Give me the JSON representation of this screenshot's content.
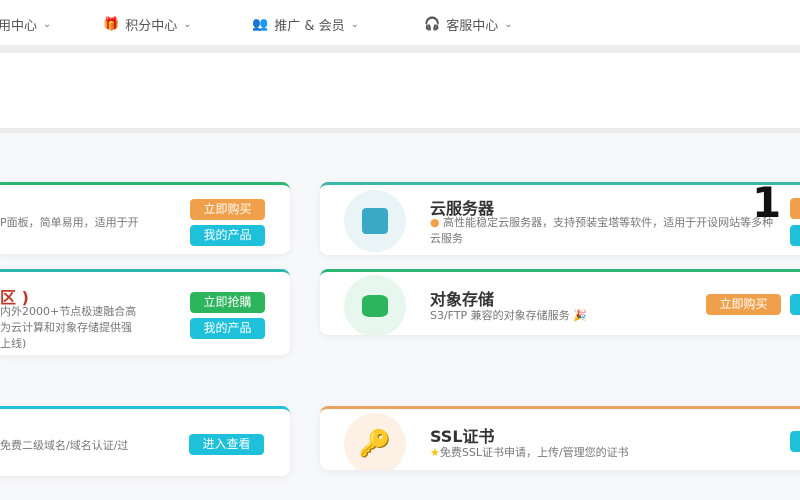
{
  "nav": [
    {
      "label": "用中心",
      "icon": "none"
    },
    {
      "label": "积分中心",
      "icon": "gift-icon"
    },
    {
      "label": "推广 & 会员",
      "icon": "users-icon"
    },
    {
      "label": "客服中心",
      "icon": "headset-icon"
    }
  ],
  "left_cards": [
    {
      "desc": "P面板，简单易用，适用于开",
      "btn1": "立即购买",
      "btn2": "我的产品"
    },
    {
      "title_fragment": "区 )",
      "desc": "内外2000+节点极速融合高\n为云计算和对象存储提供强\n上线)",
      "btn1": "立即抢購",
      "btn2": "我的产品"
    },
    {
      "desc": "免费二级域名/域名认证/过",
      "btn1": "进入查看"
    }
  ],
  "right_cards": [
    {
      "title": "云服务器",
      "desc": "高性能稳定云服务器，支持预装宝塔等软件，适用于开设网站等多种云服务",
      "icon": "cube-icon"
    },
    {
      "title": "对象存储",
      "desc": "S3/FTP 兼容的对象存储服务 🎉",
      "btn1": "立即购买",
      "icon": "database-icon"
    },
    {
      "title": "SSL证书",
      "desc": "免费SSL证书申请，上传/管理您的证书",
      "icon": "key-icon"
    }
  ],
  "overlay_number": "1",
  "colors": {
    "orange": "#f0a04b",
    "cyan": "#1fc0da",
    "green": "#2db55d",
    "teal": "#3cb8a8"
  }
}
